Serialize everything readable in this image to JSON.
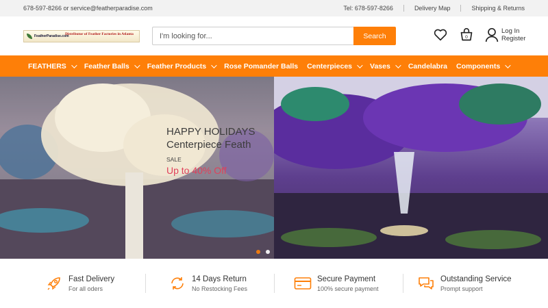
{
  "topbar": {
    "contact": "678-597-8266 or service@featherparadise.com",
    "phone": "Tel: 678-597-8266",
    "delivery_map": "Delivery Map",
    "shipping": "Shipping & Returns"
  },
  "header": {
    "logo_site": "FeatherParadise.com",
    "logo_tag": "Distributor of Feather Factories in Atlanta",
    "search_placeholder": "I'm looking for...",
    "search_button": "Search",
    "login": "Log In",
    "register": "Register"
  },
  "nav": {
    "items": [
      {
        "label": "FEATHERS",
        "dropdown": true
      },
      {
        "label": "Feather Balls",
        "dropdown": true
      },
      {
        "label": "Feather Products",
        "dropdown": true
      },
      {
        "label": "Rose Pomander Balls",
        "dropdown": false
      },
      {
        "label": "Centerpieces",
        "dropdown": true
      },
      {
        "label": "Vases",
        "dropdown": true
      },
      {
        "label": "Candelabra",
        "dropdown": false
      },
      {
        "label": "Components",
        "dropdown": true
      }
    ]
  },
  "hero": {
    "title_line1": "HAPPY HOLIDAYS",
    "title_line2": "Centerpiece Feath",
    "sale": "SALE",
    "offer": "Up to 40% Off",
    "slides": 2,
    "active_slide": 1
  },
  "features": [
    {
      "icon": "rocket-icon",
      "title": "Fast Delivery",
      "subtitle": "For all oders"
    },
    {
      "icon": "return-icon",
      "title": "14 Days Return",
      "subtitle": "No Restocking Fees"
    },
    {
      "icon": "card-icon",
      "title": "Secure Payment",
      "subtitle": "100% secure payment"
    },
    {
      "icon": "chat-icon",
      "title": "Outstanding Service",
      "subtitle": "Prompt support"
    }
  ],
  "colors": {
    "accent": "#fe7f08",
    "offer": "#e0405a"
  }
}
